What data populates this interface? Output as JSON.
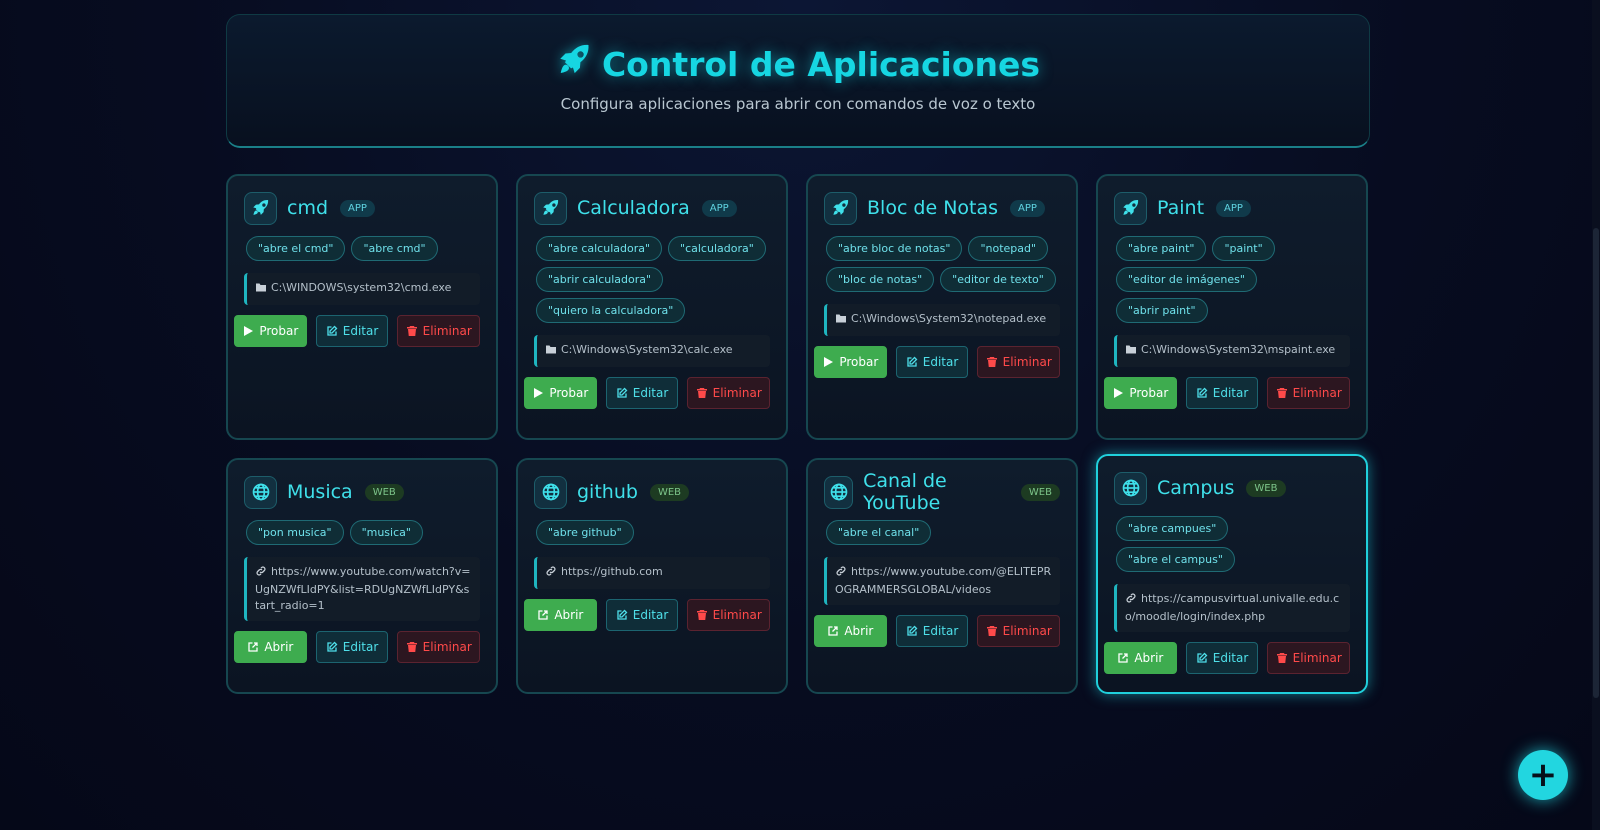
{
  "header": {
    "title": "Control de Aplicaciones",
    "subtitle": "Configura aplicaciones para abrir con comandos de voz o texto",
    "icon": "rocket-icon"
  },
  "colors": {
    "accent": "#16d6e2",
    "run": "#3eac4f",
    "delete": "#ff4a4a",
    "background": "#070c20"
  },
  "apps": [
    {
      "name": "cmd",
      "type": "APP",
      "icon": "rocket-icon",
      "commands": [
        "\"abre el cmd\"",
        "\"abre cmd\""
      ],
      "target": "C:\\WINDOWS\\system32\\cmd.exe",
      "actions": {
        "run": "Probar",
        "edit": "Editar",
        "delete": "Eliminar"
      }
    },
    {
      "name": "Calculadora",
      "type": "APP",
      "icon": "rocket-icon",
      "commands": [
        "\"abre calculadora\"",
        "\"calculadora\"",
        "\"abrir calculadora\"",
        "\"quiero la calculadora\""
      ],
      "target": "C:\\Windows\\System32\\calc.exe",
      "actions": {
        "run": "Probar",
        "edit": "Editar",
        "delete": "Eliminar"
      }
    },
    {
      "name": "Bloc de Notas",
      "type": "APP",
      "icon": "rocket-icon",
      "commands": [
        "\"abre bloc de notas\"",
        "\"notepad\"",
        "\"bloc de notas\"",
        "\"editor de texto\""
      ],
      "target": "C:\\Windows\\System32\\notepad.exe",
      "actions": {
        "run": "Probar",
        "edit": "Editar",
        "delete": "Eliminar"
      }
    },
    {
      "name": "Paint",
      "type": "APP",
      "icon": "rocket-icon",
      "commands": [
        "\"abre paint\"",
        "\"paint\"",
        "\"editor de imágenes\"",
        "\"abrir paint\""
      ],
      "target": "C:\\Windows\\System32\\mspaint.exe",
      "actions": {
        "run": "Probar",
        "edit": "Editar",
        "delete": "Eliminar"
      }
    },
    {
      "name": "Musica",
      "type": "WEB",
      "icon": "globe-icon",
      "commands": [
        "\"pon musica\"",
        "\"musica\""
      ],
      "target": "https://www.youtube.com/watch?v=UgNZWfLIdPY&list=RDUgNZWfLIdPY&start_radio=1",
      "actions": {
        "run": "Abrir",
        "edit": "Editar",
        "delete": "Eliminar"
      }
    },
    {
      "name": "github",
      "type": "WEB",
      "icon": "globe-icon",
      "commands": [
        "\"abre github\""
      ],
      "target": "https://github.com",
      "actions": {
        "run": "Abrir",
        "edit": "Editar",
        "delete": "Eliminar"
      }
    },
    {
      "name": "Canal de YouTube",
      "type": "WEB",
      "icon": "globe-icon",
      "commands": [
        "\"abre el canal\""
      ],
      "target": "https://www.youtube.com/@ELITEPROGRAMMERSGLOBAL/videos",
      "actions": {
        "run": "Abrir",
        "edit": "Editar",
        "delete": "Eliminar"
      }
    },
    {
      "name": "Campus",
      "type": "WEB",
      "icon": "globe-icon",
      "commands": [
        "\"abre campues\"",
        "\"abre el campus\""
      ],
      "target": "https://campusvirtual.univalle.edu.co/moodle/login/index.php",
      "actions": {
        "run": "Abrir",
        "edit": "Editar",
        "delete": "Eliminar"
      }
    }
  ],
  "fab": {
    "label": "+",
    "icon": "plus-icon"
  }
}
